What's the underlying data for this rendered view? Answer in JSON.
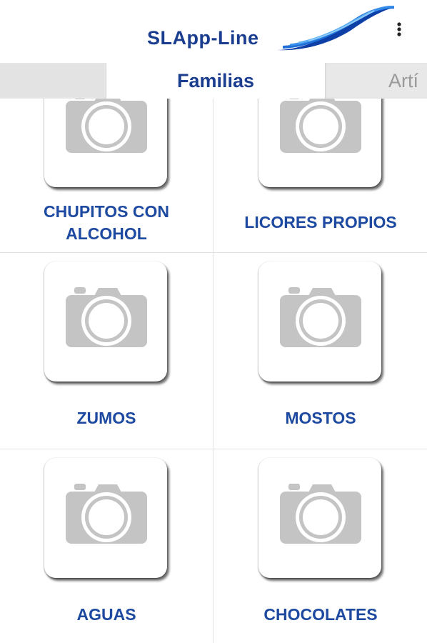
{
  "header": {
    "title": "SLApp-Line",
    "menu_icon": "more-vert-icon"
  },
  "tabs": [
    {
      "label": ""
    },
    {
      "label": "Familias"
    },
    {
      "label": "Artí"
    }
  ],
  "families": [
    {
      "label": "CHUPITOS CON ALCOHOL",
      "image_icon": "camera-placeholder-icon"
    },
    {
      "label": "LICORES PROPIOS",
      "image_icon": "camera-placeholder-icon"
    },
    {
      "label": "ZUMOS",
      "image_icon": "camera-placeholder-icon"
    },
    {
      "label": "MOSTOS",
      "image_icon": "camera-placeholder-icon"
    },
    {
      "label": "AGUAS",
      "image_icon": "camera-placeholder-icon"
    },
    {
      "label": "CHOCOLATES",
      "image_icon": "camera-placeholder-icon"
    }
  ],
  "colors": {
    "brand": "#1b3d8f",
    "label": "#1d4aa0",
    "logo_blue": "#1e6fd9"
  }
}
